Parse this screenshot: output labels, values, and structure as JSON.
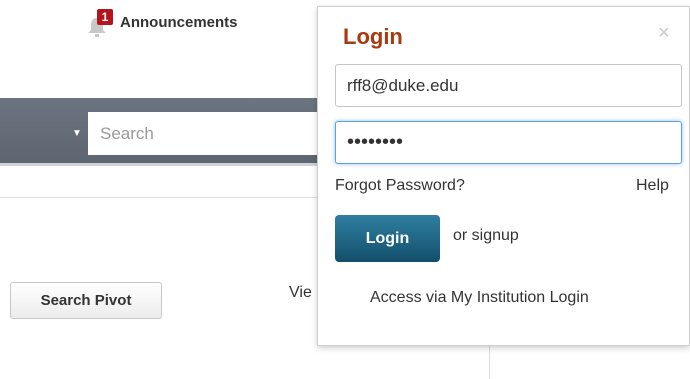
{
  "header": {
    "announcements_label": "Announcements",
    "announcements_count": "1"
  },
  "nav": {
    "search_placeholder": "Search"
  },
  "main": {
    "search_pivot_label": "Search Pivot",
    "view_link_text": "Vie"
  },
  "login": {
    "title": "Login",
    "close_glyph": "×",
    "email_value": "rff8@duke.edu",
    "password_mask": "••••••••",
    "forgot_password": "Forgot Password?",
    "help": "Help",
    "login_button": "Login",
    "signup_text": "or signup",
    "institution_link": "Access via My Institution Login"
  },
  "colors": {
    "brand_title": "#a63a10",
    "login_button": "#1a5a78",
    "badge": "#b3151b",
    "navbar": "#646c77"
  },
  "icons": {
    "announcements": "bell-icon",
    "nav_dropdown": "caret-down-icon",
    "close": "close-icon"
  }
}
